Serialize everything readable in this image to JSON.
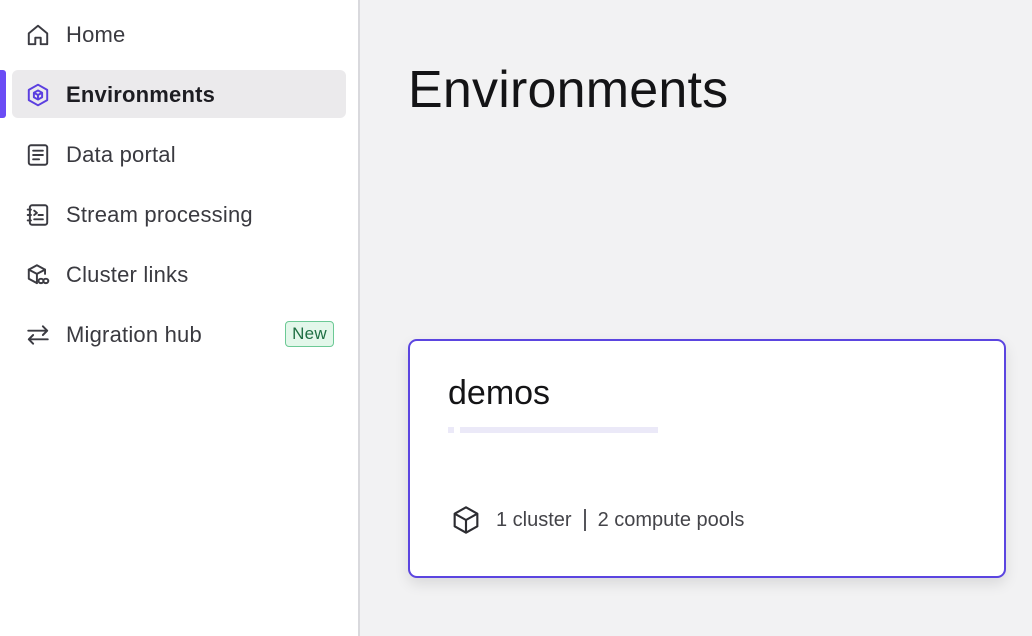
{
  "sidebar": {
    "items": [
      {
        "label": "Home",
        "icon": "home-icon"
      },
      {
        "label": "Environments",
        "icon": "environment-hexagon-icon",
        "active": true
      },
      {
        "label": "Data portal",
        "icon": "document-icon"
      },
      {
        "label": "Stream processing",
        "icon": "terminal-notebook-icon"
      },
      {
        "label": "Cluster links",
        "icon": "cube-link-icon"
      },
      {
        "label": "Migration hub",
        "icon": "arrows-swap-icon",
        "badge": "New"
      }
    ]
  },
  "main": {
    "title": "Environments",
    "environment_card": {
      "name": "demos",
      "clusters": "1 cluster",
      "compute_pools": "2 compute pools",
      "icon": "cube-icon"
    }
  },
  "colors": {
    "accent": "#6a4cf5",
    "card_border": "#5b45e0",
    "badge_bg": "#e3f7ea",
    "badge_border": "#6cc995",
    "badge_text": "#1f6f43"
  }
}
